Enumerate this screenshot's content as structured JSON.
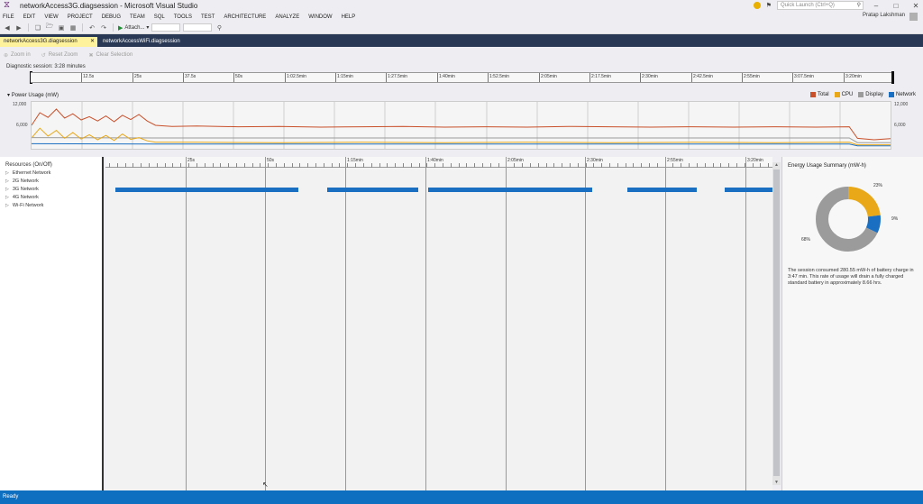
{
  "window": {
    "title": "networkAccess3G.diagsession - Microsoft Visual Studio",
    "quick_launch_placeholder": "Quick Launch (Ctrl+Q)",
    "user": "Pratap Lakshman"
  },
  "menu": [
    "FILE",
    "EDIT",
    "VIEW",
    "PROJECT",
    "DEBUG",
    "TEAM",
    "SQL",
    "TOOLS",
    "TEST",
    "ARCHITECTURE",
    "ANALYZE",
    "WINDOW",
    "HELP"
  ],
  "toolbar": {
    "attach_label": "Attach..."
  },
  "tabs": [
    {
      "label": "networkAccess3G.diagsession",
      "active": true
    },
    {
      "label": "networkAccessWiFi.diagsession",
      "active": false
    }
  ],
  "diag_toolbar": {
    "zoom_in": "Zoom in",
    "reset_zoom": "Reset Zoom",
    "clear_selection": "Clear Selection"
  },
  "session": {
    "label": "Diagnostic session: 3:28 minutes",
    "ruler_labels": [
      "12.5s",
      "25s",
      "37.5s",
      "50s",
      "1:02.5min",
      "1:15min",
      "1:27.5min",
      "1:40min",
      "1:52.5min",
      "2:05min",
      "2:17.5min",
      "2:30min",
      "2:42.5min",
      "2:55min",
      "3:07.5min",
      "3:20min"
    ]
  },
  "power": {
    "header": "Power Usage (mW)",
    "y_max": "12,000",
    "y_mid": "6,000",
    "legend": [
      {
        "label": "Total",
        "color": "#c8502a"
      },
      {
        "label": "CPU",
        "color": "#e8a817"
      },
      {
        "label": "Display",
        "color": "#9b9b9b"
      },
      {
        "label": "Network",
        "color": "#1b6fc2"
      }
    ]
  },
  "chart_data": {
    "type": "line",
    "ylim": [
      0,
      12000
    ],
    "y_ticks": [
      "12,000",
      "6,000"
    ],
    "x_range_seconds": [
      0,
      208
    ],
    "series": [
      {
        "name": "Total",
        "color": "#c8502a",
        "x": [
          0,
          2,
          4,
          6,
          8,
          10,
          12,
          14,
          16,
          18,
          20,
          22,
          24,
          26,
          28,
          30,
          34,
          40,
          50,
          60,
          70,
          80,
          90,
          100,
          110,
          120,
          130,
          140,
          150,
          160,
          170,
          180,
          190,
          198,
          200,
          204,
          208
        ],
        "values": [
          6000,
          9500,
          8200,
          10500,
          8000,
          9200,
          7500,
          8400,
          7200,
          8600,
          7000,
          8800,
          7600,
          9000,
          7200,
          6000,
          5700,
          5800,
          5600,
          5700,
          5500,
          5600,
          5700,
          5500,
          5600,
          5500,
          5700,
          5600,
          5500,
          5600,
          5500,
          5600,
          5500,
          5600,
          2400,
          2000,
          2300
        ]
      },
      {
        "name": "CPU",
        "color": "#e8a817",
        "x": [
          0,
          2,
          4,
          6,
          8,
          10,
          12,
          14,
          16,
          18,
          20,
          22,
          24,
          26,
          28,
          30,
          40,
          60,
          80,
          100,
          120,
          140,
          160,
          180,
          198,
          200,
          208
        ],
        "values": [
          2500,
          5200,
          3000,
          4600,
          2400,
          4000,
          2200,
          3400,
          2000,
          3200,
          1800,
          3600,
          2100,
          2600,
          1700,
          1300,
          1300,
          1200,
          1300,
          1200,
          1300,
          1200,
          1300,
          1200,
          1300,
          600,
          600
        ]
      },
      {
        "name": "Display",
        "color": "#9b9b9b",
        "x": [
          0,
          30,
          60,
          100,
          150,
          198,
          200,
          208
        ],
        "values": [
          2600,
          2500,
          2500,
          2500,
          2500,
          2500,
          1200,
          1200
        ]
      },
      {
        "name": "Network",
        "color": "#1b6fc2",
        "x": [
          0,
          30,
          60,
          100,
          150,
          198,
          200,
          208
        ],
        "values": [
          900,
          800,
          800,
          800,
          800,
          800,
          300,
          300
        ]
      }
    ]
  },
  "resources": {
    "header": "Resources (On/Off)",
    "items": [
      "Ethernet Network",
      "2G Network",
      "3G Network",
      "4G Network",
      "Wi-Fi Network"
    ]
  },
  "timeline": {
    "labels": [
      "25s",
      "50s",
      "1:15min",
      "1:40min",
      "2:05min",
      "2:30min",
      "2:55min",
      "3:20min"
    ],
    "network_on_segments_seconds": [
      [
        3,
        61
      ],
      [
        70,
        99
      ],
      [
        102,
        154
      ],
      [
        165,
        187
      ],
      [
        196,
        211
      ]
    ],
    "range_seconds": [
      0,
      211
    ]
  },
  "summary": {
    "title": "Energy Usage Summary (mW-h)",
    "segments": [
      {
        "label": "CPU",
        "pct": 23,
        "pct_text": "23%",
        "color": "#e8a817"
      },
      {
        "label": "Network",
        "pct": 9,
        "pct_text": "9%",
        "color": "#1b6fc2"
      },
      {
        "label": "Display",
        "pct": 68,
        "pct_text": "68%",
        "color": "#9b9b9b"
      }
    ],
    "text": "The session consumed 280.55 mW-h of battery charge in 3:47 min. This rate of usage will drain a fully charged standard battery in approximately 8.66 hrs."
  },
  "status": {
    "text": "Ready"
  }
}
